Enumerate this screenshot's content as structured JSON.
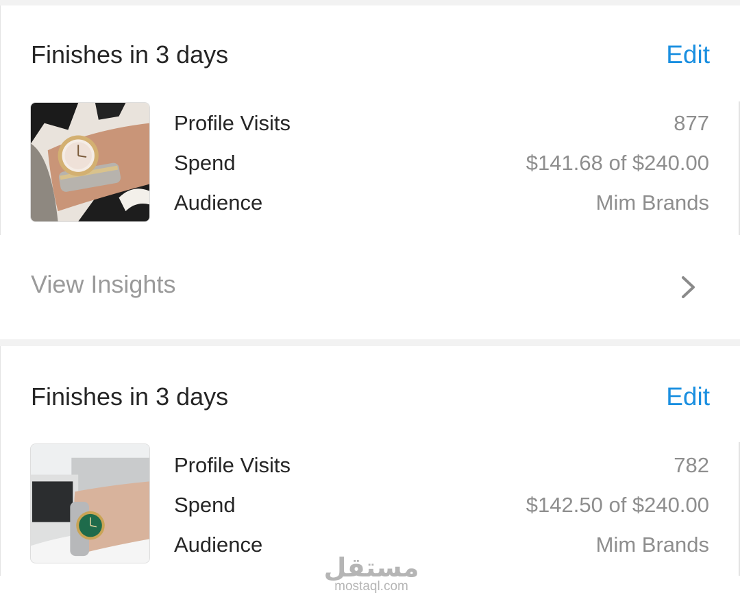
{
  "campaigns": [
    {
      "status_title": "Finishes in 3 days",
      "edit_label": "Edit",
      "thumbnail": "watch-on-wrist-rose-gold",
      "metrics": [
        {
          "label": "Profile Visits",
          "value": "877"
        },
        {
          "label": "Spend",
          "value": "$141.68 of $240.00"
        },
        {
          "label": "Audience",
          "value": "Mim Brands"
        }
      ],
      "insights_label": "View Insights",
      "insights_icon": "chevron-right-icon"
    },
    {
      "status_title": "Finishes in 3 days",
      "edit_label": "Edit",
      "thumbnail": "watch-on-wrist-green-dial",
      "metrics": [
        {
          "label": "Profile Visits",
          "value": "782"
        },
        {
          "label": "Spend",
          "value": "$142.50 of $240.00"
        },
        {
          "label": "Audience",
          "value": "Mim Brands"
        }
      ]
    }
  ],
  "watermark": {
    "logo": "مستقل",
    "text": "mostaql.com"
  },
  "colors": {
    "accent": "#1a8fe0",
    "text": "#262626",
    "muted": "#8e8e8e",
    "background": "#f2f2f2"
  }
}
